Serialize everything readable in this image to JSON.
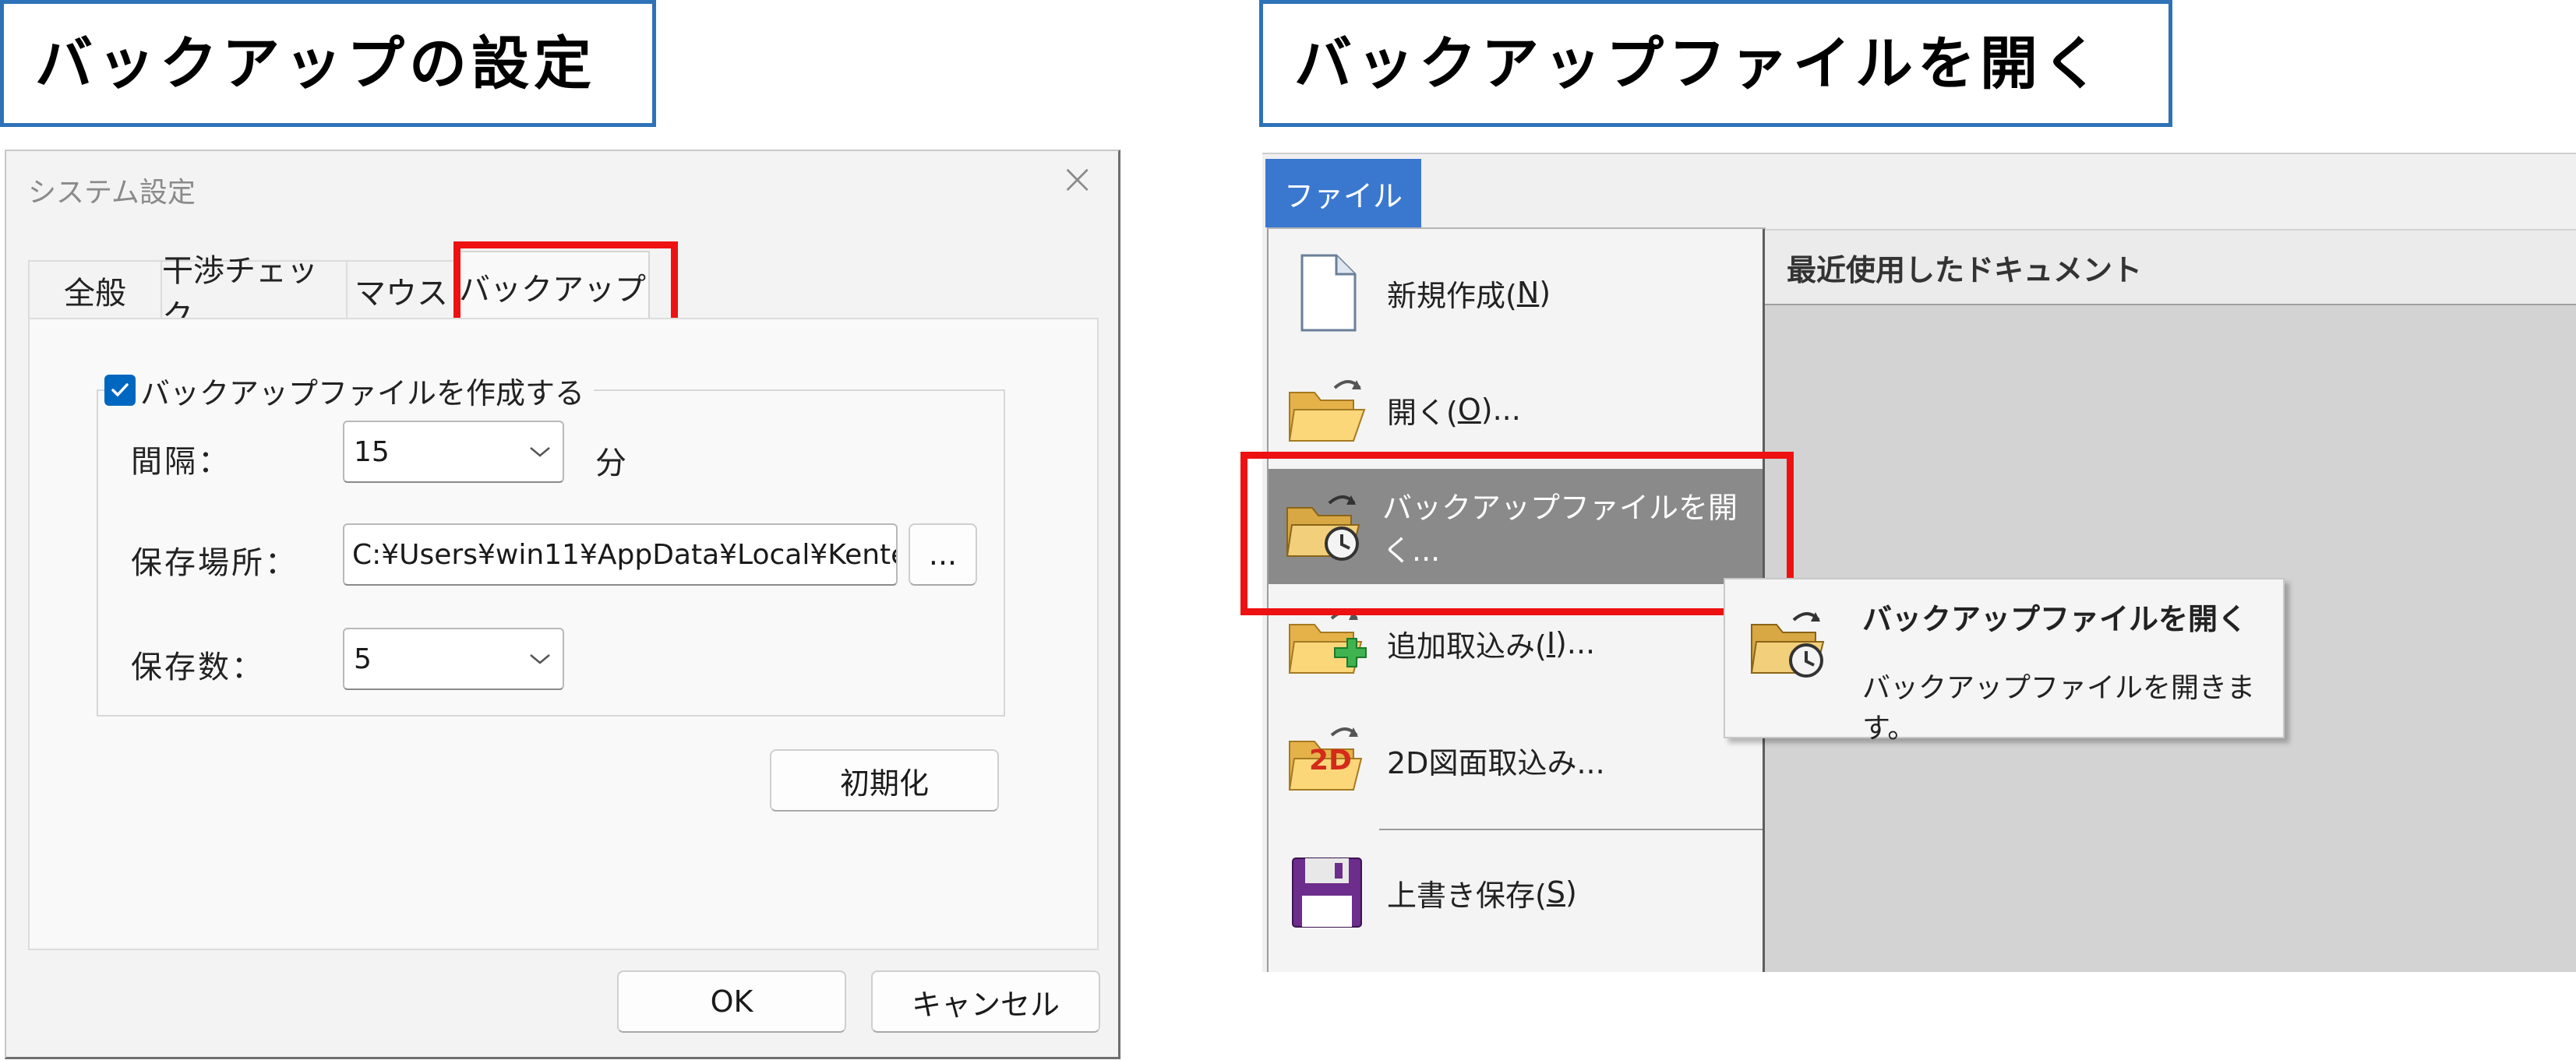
{
  "left_section": {
    "header": "バックアップの設定",
    "dialog": {
      "title": "システム設定",
      "close_glyph": "×",
      "tabs": [
        {
          "label": "全般",
          "active": false
        },
        {
          "label": "干渉チェック",
          "active": false
        },
        {
          "label": "マウス",
          "active": false
        },
        {
          "label": "バックアップ",
          "active": true
        }
      ],
      "group": {
        "checkbox_label": "バックアップファイルを作成する",
        "checked": true,
        "interval_label": "間隔：",
        "interval_value": "15",
        "interval_unit": "分",
        "location_label": "保存場所：",
        "location_value": "C:¥Users¥win11¥AppData¥Local¥Kente",
        "browse_label": "...",
        "count_label": "保存数：",
        "count_value": "5"
      },
      "reset_button": "初期化",
      "ok_button": "OK",
      "cancel_button": "キャンセル"
    }
  },
  "right_section": {
    "header": "バックアップファイルを開く",
    "file_tab": "ファイル",
    "menu_items": [
      {
        "label": "新規作成(N)",
        "text": "新規作成(",
        "key": "N",
        "suffix": ")",
        "icon": "new-document-icon"
      },
      {
        "label": "開く(O)...",
        "text": "開く(",
        "key": "O",
        "suffix": ")...",
        "icon": "open-folder-icon"
      },
      {
        "label": "バックアップファイルを開く...",
        "text": "バックアップファイルを開く...",
        "key": "",
        "suffix": "",
        "icon": "backup-folder-icon",
        "highlighted": true
      },
      {
        "label": "追加取込み(I)...",
        "text": "追加取込み(",
        "key": "I",
        "suffix": ")...",
        "icon": "add-import-folder-icon"
      },
      {
        "label": "2D図面取込み...",
        "text": "2D図面取込み...",
        "key": "",
        "suffix": "",
        "icon": "2d-import-folder-icon"
      },
      {
        "label": "上書き保存(S)",
        "text": "上書き保存(",
        "key": "S",
        "suffix": ")",
        "icon": "floppy-save-icon"
      }
    ],
    "recent_header": "最近使用したドキュメント",
    "tooltip": {
      "title": "バックアップファイルを開く",
      "description": "バックアップファイルを開きます。"
    },
    "icon_text_2d": "2D"
  },
  "colors": {
    "header_border": "#2e72b8",
    "highlight_red": "#ee1111",
    "checkbox_blue": "#0067c0",
    "file_tab_blue": "#3a78d0",
    "menu_highlight": "#8a8a8a"
  }
}
